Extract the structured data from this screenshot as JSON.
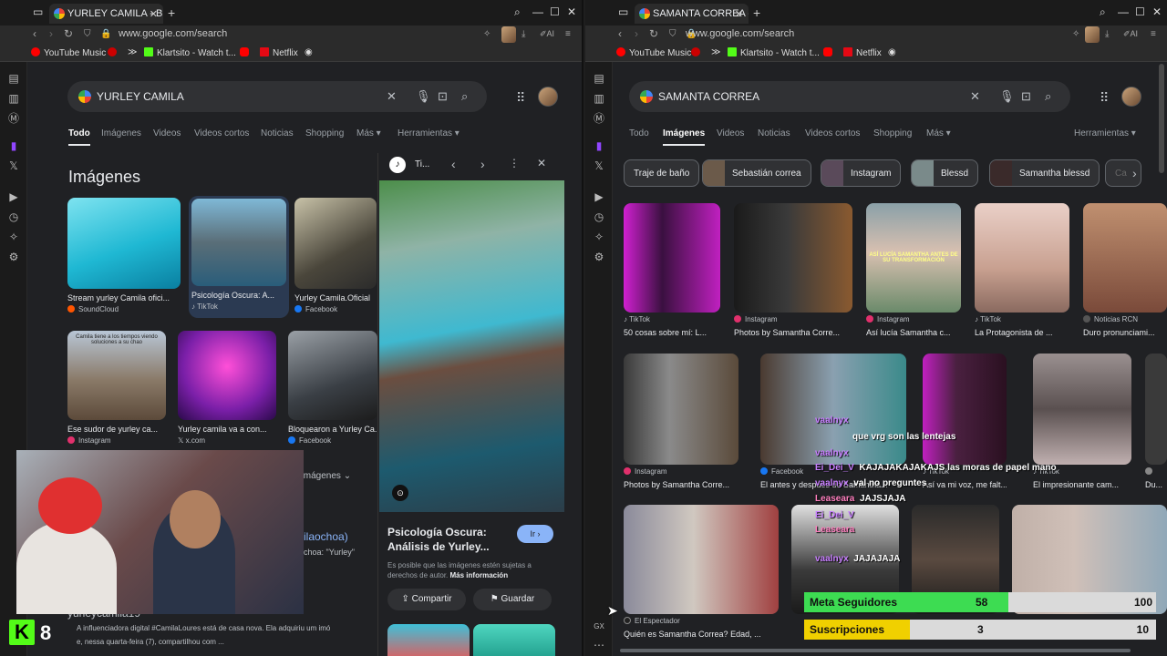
{
  "left": {
    "tab_title": "YURLEY CAMILA - Buscar",
    "url": "www.google.com/search",
    "bookmarks": [
      "YouTube Music",
      "Klartsito - Watch t...",
      "Netflix"
    ],
    "query": "YURLEY CAMILA",
    "tabs": [
      "Todo",
      "Imágenes",
      "Videos",
      "Videos cortos",
      "Noticias",
      "Shopping",
      "Más ▾",
      "Herramientas ▾"
    ],
    "section_title": "Imágenes",
    "results": [
      {
        "caption": "Stream yurley Camila ofici...",
        "source": "SoundCloud"
      },
      {
        "caption": "Psicología Oscura: A...",
        "source": "TikTok"
      },
      {
        "caption": "Yurley Camila.Oficial",
        "source": "Facebook"
      },
      {
        "caption": "Ese sudor de yurley ca...",
        "source": "Instagram"
      },
      {
        "caption": "Yurley camila va a con...",
        "source": "x.com"
      },
      {
        "caption": "Bloquearon a Yurley Ca...",
        "source": "Facebook"
      }
    ],
    "thumb_text": "Camila tiene a los tiempos viendo soluciones a su chao",
    "more_images": "Imágenes",
    "partial_text_1": "ilaochoa)",
    "partial_text_2": "choa: \"Yurley\"",
    "username": "yurleycamila19",
    "snippet_1": "A influenciadora digital #CamilaLoures está de casa nova. Ela adquiriu um imó",
    "snippet_2": "e, nessa quarta-feira (7), compartilhou com ...",
    "panel": {
      "source": "Ti...",
      "title": "Psicología Oscura: Análisis de Yurley...",
      "go": "Ir ›",
      "rights": "Es posible que las imágenes estén sujetas a derechos de autor.",
      "more_info": "Más información",
      "share": "Compartir",
      "save": "Guardar"
    }
  },
  "right": {
    "tab_title": "SAMANTA CORREA - Buscar",
    "url": "www.google.com/search",
    "bookmarks": [
      "YouTube Music",
      "Klartsito - Watch t...",
      "Netflix"
    ],
    "query": "SAMANTA CORREA",
    "tabs": [
      "Todo",
      "Imágenes",
      "Videos",
      "Noticias",
      "Videos cortos",
      "Shopping",
      "Más ▾",
      "Herramientas ▾"
    ],
    "chips": [
      "Traje de baño",
      "Sebastián correa",
      "Instagram",
      "Blessd",
      "Samantha blessd"
    ],
    "row1": [
      {
        "source": "TikTok",
        "caption": "50 cosas sobre mí: L..."
      },
      {
        "source": "Instagram",
        "caption": "Photos by Samantha Corre..."
      },
      {
        "source": "Instagram",
        "caption": "Así lucía Samantha c..."
      },
      {
        "source": "TikTok",
        "caption": "La Protagonista de ..."
      },
      {
        "source": "Noticias RCN",
        "caption": "Duro pronunciami..."
      }
    ],
    "row2": [
      {
        "source": "Instagram",
        "caption": "Photos by Samantha Corre..."
      },
      {
        "source": "Facebook",
        "caption": "El antes y después de Samantha..."
      },
      {
        "source": "TikTok",
        "caption": "Así va mi voz, me falt..."
      },
      {
        "source": "TikTok",
        "caption": "El impresionante cam..."
      },
      {
        "source": "",
        "caption": "Du..."
      }
    ],
    "thumb_text": "ASÍ LUCÍA SAMANTHA ANTES DE SU TRANSFORMACIÓN",
    "row3_source": "El Espectador",
    "row3_caption": "Quién es Samantha Correa? Edad, ..."
  },
  "stream": {
    "logo_number": "8",
    "meta": {
      "label": "Meta Seguidores",
      "value": "58",
      "goal": "100",
      "progress": 0.58
    },
    "subs": {
      "label": "Suscripciones",
      "value": "3",
      "goal": "10",
      "progress": 0.3
    },
    "chat": [
      {
        "user": "vaalnyx",
        "text": "que vrg son las lentejas"
      },
      {
        "user": "Ei_Dei_V",
        "text": "KAJAJAKAJAKAJS las moras de papel mano"
      },
      {
        "user": "vaalnyx",
        "text": "val no preguntes"
      },
      {
        "user": "Leaseara",
        "text": "JAJSJAJA"
      },
      {
        "user": "Ei_Dei_V",
        "text": "JAJAJAJA"
      }
    ]
  },
  "colors": {
    "accent": "#8ab4f8",
    "meta_fill": "#3ddc52",
    "subs_fill": "#f0d000",
    "stream_green": "#53fc18"
  },
  "icons": [
    "opera-logo",
    "sidebar-icon",
    "search-icon",
    "mic-icon",
    "lens-icon",
    "apps-icon",
    "close-icon",
    "chevron-icon"
  ]
}
